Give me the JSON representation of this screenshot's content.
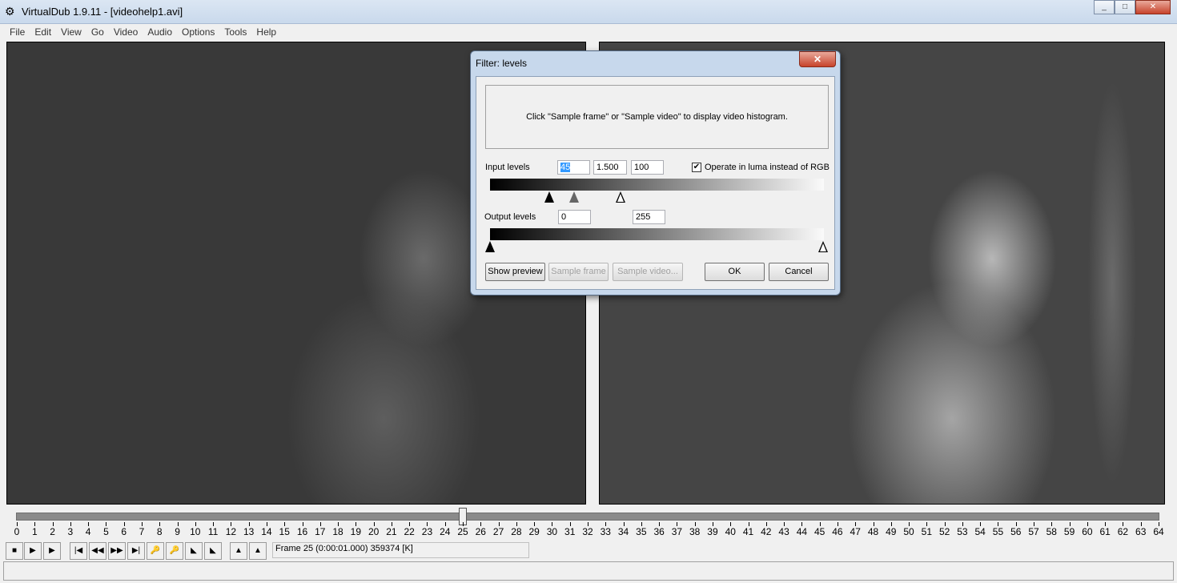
{
  "window": {
    "title": "VirtualDub 1.9.11 - [videohelp1.avi]",
    "icon": "virtualdub-film-icon",
    "controls": [
      "_",
      "□",
      "✕"
    ]
  },
  "menu": [
    "File",
    "Edit",
    "View",
    "Go",
    "Video",
    "Audio",
    "Options",
    "Tools",
    "Help"
  ],
  "dialog": {
    "title": "Filter: levels",
    "close": "✕",
    "histogram_text": "Click \"Sample frame\" or \"Sample video\" to display video histogram.",
    "input_label": "Input levels",
    "input_black": "45",
    "input_gamma": "1.500",
    "input_white": "100",
    "luma_checkbox": "Operate in luma instead of RGB",
    "luma_checked": true,
    "output_label": "Output levels",
    "output_black": "0",
    "output_white": "255",
    "buttons": {
      "show_preview": "Show preview",
      "sample_frame": "Sample frame",
      "sample_video": "Sample video...",
      "ok": "OK",
      "cancel": "Cancel"
    }
  },
  "timeline": {
    "min": 0,
    "max": 64,
    "current": 25
  },
  "toolbar_icons": [
    "stop-icon",
    "play-input-icon",
    "play-output-icon",
    "go-start-icon",
    "prev-key-icon",
    "next-key-icon",
    "go-end-icon",
    "prev-keyframe-icon",
    "next-keyframe-icon",
    "prev-scene-icon",
    "next-scene-icon",
    "mark-in-icon",
    "mark-out-icon"
  ],
  "frame_status": "Frame 25 (0:00:01.000) 359374 [K]"
}
